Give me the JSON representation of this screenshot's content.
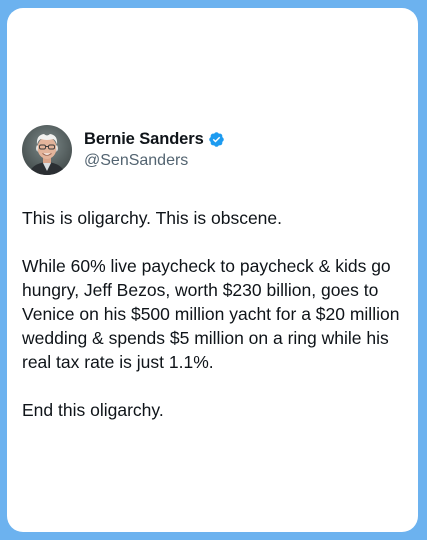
{
  "post": {
    "author": {
      "display_name": "Bernie Sanders",
      "handle": "@SenSanders",
      "verified": true,
      "verified_icon": "verified-badge-icon"
    },
    "paragraphs": [
      "This is oligarchy. This is obscene.",
      "While 60% live paycheck to paycheck & kids go hungry, Jeff Bezos, worth $230 billion, goes to Venice on his $500 million yacht for a $20 million wedding & spends $5 million on a ring while his real tax rate is just 1.1%.",
      "End this oligarchy."
    ]
  },
  "colors": {
    "background": "#6cb2ef",
    "card": "#ffffff",
    "text": "#0f1419",
    "handle": "#536471",
    "verified": "#1d9bf0"
  }
}
